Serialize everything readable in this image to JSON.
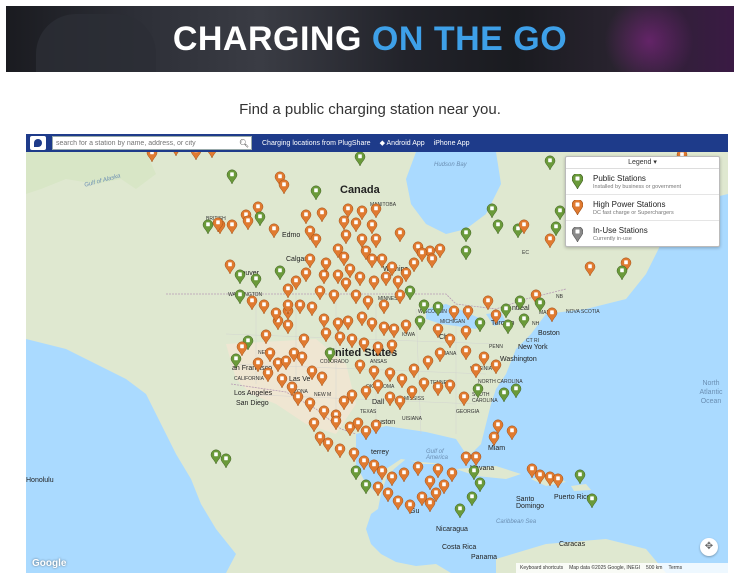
{
  "hero": {
    "title_main": "CHARGING ",
    "title_accent": "ON THE GO"
  },
  "tagline": "Find a public charging station near you.",
  "toolbar": {
    "search_placeholder": "search for a station by name, address, or city",
    "search_icon": "search-icon",
    "link_plugshare": "Charging locations from PlugShare",
    "link_android": "Android App",
    "link_iphone": "iPhone App",
    "android_icon": "◆",
    "iphone_icon": ""
  },
  "legend": {
    "header": "Legend ▾",
    "items": [
      {
        "title": "Public Stations",
        "subtitle": "Installed by business or government",
        "color": "#6a9a3a"
      },
      {
        "title": "High Power Stations",
        "subtitle": "DC fast charge or Superchargers",
        "color": "#e07a30"
      },
      {
        "title": "In-Use Stations",
        "subtitle": "Currently in-use",
        "color": "#8a8a8a"
      }
    ]
  },
  "map_labels": {
    "canada": "Canada",
    "united_states": "United States",
    "hudson_bay": "Hudson Bay",
    "gulf_alaska": "Gulf of Alaska",
    "north_atlantic": "North Atlantic Ocean",
    "gulf_america": "Gulf of America",
    "caribbean": "Caribbean Sea",
    "british": "BRITISH",
    "manitoba": "MANITOBA",
    "washington": "WASHINGTON",
    "edmonton": "Edmo",
    "calgary": "Calgar",
    "vancouver": "couver",
    "winnipeg": "Winnipe",
    "colorado": "COLORADO",
    "california": "CALIFORNIA",
    "san_francisco": "an Francisco",
    "las_vegas": "Las Ve",
    "los_angeles": "Los Angeles",
    "san_diego": "San Diego",
    "dallas": "Dall",
    "houston": "uston",
    "chicago": "Chic",
    "toronto": "Toronto",
    "boston": "Boston",
    "new_york": "New York",
    "washington_dc": "Washington",
    "miami": "Miam",
    "havana": "Havana",
    "honolulu": "Honolulu",
    "puerto_rico": "Puerto Rico",
    "santo_domingo": "Santo Domingo",
    "nicaragua": "Nicaragua",
    "costa_rica": "Costa Rica",
    "panama": "Panama",
    "caracas": "Caracas",
    "montreal": "ntreal",
    "guatemala": "Gu",
    "monterrey": "terrey",
    "iowa": "IOWA",
    "kansas": "ANSAS",
    "nevada": "NEVA",
    "arizona": "ZONA",
    "new_mexico": "NEW M",
    "texas": "TEXAS",
    "oklahoma": "OKLAHOMA",
    "louisiana": "UISIANA",
    "mississippi": "MISSISS",
    "tennessee": "TENNES",
    "georgia": "GEORGIA",
    "south_carolina": "SOUTH CAROLINA",
    "north_carolina": "NORTH CAROLINA",
    "virginia": "VIRGINIA",
    "penn": "PENN",
    "indiana": "INDIANA",
    "michigan": "MICHIGAN",
    "wisconsin": "WISCONSIN",
    "minnesota": "MINNES",
    "nova_scotia": "NOVA SCOTIA",
    "maine": "MAINE",
    "nb": "NB",
    "nh": "NH",
    "ct": "CT RI",
    "quebec": "EC"
  },
  "footer": {
    "keyboard": "Keyboard shortcuts",
    "mapdata": "Map data ©2025 Google, INEGI",
    "scale": "500 km",
    "terms": "Terms",
    "google": "Google"
  },
  "colors": {
    "public": "#6a9a3a",
    "high_power": "#e07a30",
    "in_use": "#8a8a8a",
    "toolbar": "#1e3b8a",
    "accent": "#3ea0e8"
  }
}
